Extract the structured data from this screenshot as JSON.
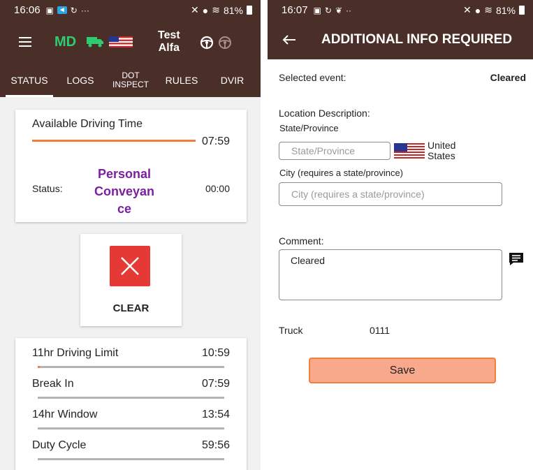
{
  "left_screen": {
    "statusbar": {
      "time": "16:06",
      "extra": "···",
      "battery": "81%"
    },
    "appbar": {
      "brand": "MD",
      "driver_name_line1": "Test",
      "driver_name_line2": "Alfa"
    },
    "tabs": [
      {
        "label": "STATUS",
        "active": true
      },
      {
        "label": "LOGS",
        "active": false
      },
      {
        "label_line1": "DOT",
        "label_line2": "INSPECT",
        "active": false
      },
      {
        "label": "RULES",
        "active": false
      },
      {
        "label": "DVIR",
        "active": false
      }
    ],
    "driving_card": {
      "title": "Available Driving Time",
      "time": "07:59",
      "progress": 1.0,
      "status_label": "Status:",
      "status_line1": "Personal",
      "status_line2": "Conveyan",
      "status_line3": "ce",
      "status_time": "00:00"
    },
    "clear_button": {
      "label": "CLEAR"
    },
    "limits": [
      {
        "label": "11hr Driving Limit",
        "value": "10:59",
        "progress": 0.01
      },
      {
        "label": "Break In",
        "value": "07:59",
        "progress": 0
      },
      {
        "label": "14hr Window",
        "value": "13:54",
        "progress": 0
      },
      {
        "label": "Duty Cycle",
        "value": "59:56",
        "progress": 0
      }
    ]
  },
  "right_screen": {
    "statusbar": {
      "time": "16:07",
      "extra": "··",
      "battery": "81%"
    },
    "title": "ADDITIONAL INFO REQUIRED",
    "selected_event_label": "Selected event:",
    "selected_event_value": "Cleared",
    "location_label": "Location Description:",
    "state_label": "State/Province",
    "state_placeholder": "State/Province",
    "country_line1": "United",
    "country_line2": "States",
    "city_label": "City (requires a state/province)",
    "city_placeholder": "City (requires a state/province)",
    "comment_label": "Comment:",
    "comment_value": "Cleared",
    "truck_label": "Truck",
    "truck_value": "0111",
    "save_label": "Save"
  },
  "colors": {
    "appbar_brown": "#4a2f28",
    "accent_orange": "#ef7f3c",
    "status_purple": "#7b1fa2",
    "brand_green": "#2ecc71",
    "clear_red": "#e53935",
    "save_fill": "#f8a98c"
  }
}
